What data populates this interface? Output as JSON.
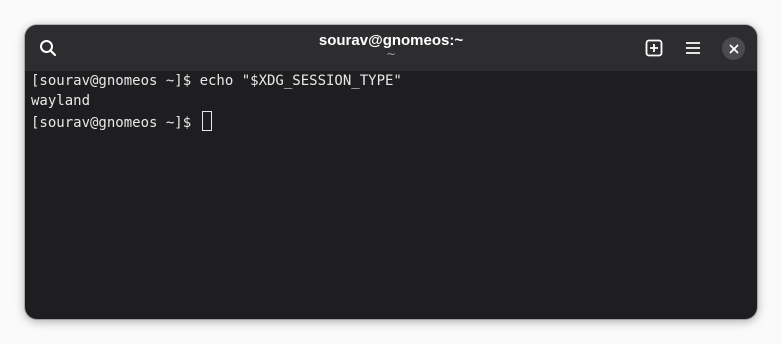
{
  "window": {
    "title": "sourav@gnomeos:~",
    "subtitle": "~"
  },
  "headerbar": {
    "search_icon": "search-icon",
    "new_tab_icon": "new-tab-icon",
    "menu_icon": "hamburger-menu-icon",
    "close_icon": "close-icon"
  },
  "terminal": {
    "lines": [
      "[sourav@gnomeos ~]$ echo \"$XDG_SESSION_TYPE\"",
      "wayland",
      "[sourav@gnomeos ~]$ "
    ]
  },
  "colors": {
    "background": "#1e1e20",
    "headerbar": "#2d2d30",
    "foreground": "#e8e8e8"
  }
}
